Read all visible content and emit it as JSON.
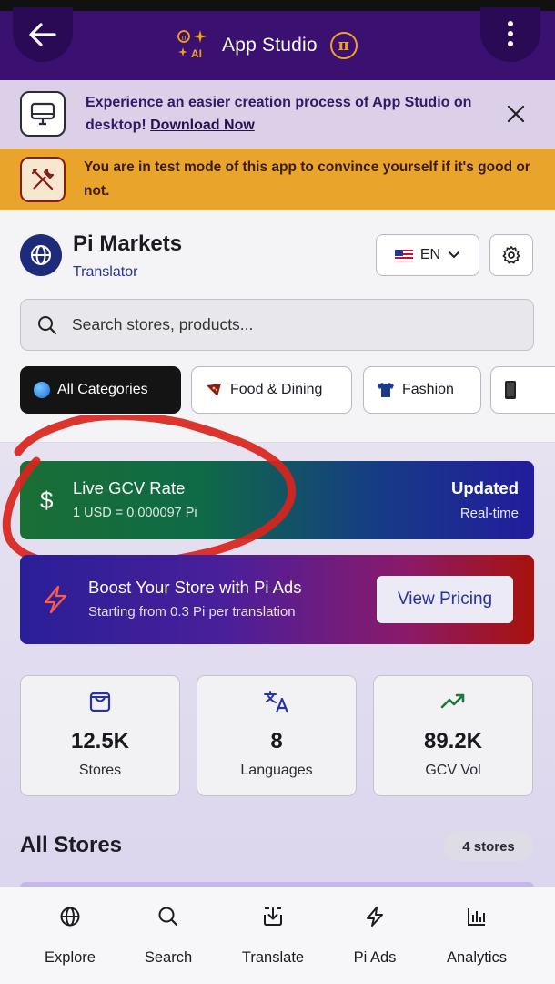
{
  "app_bar": {
    "title": "App Studio",
    "ai_badge": "AI",
    "pi_symbol": "π"
  },
  "desktop_banner": {
    "text": "Experience an easier creation process of App Studio on desktop!",
    "link": "Download Now",
    "icon": "monitor-icon"
  },
  "test_banner": {
    "text": "You are in test mode of this app to convince yourself if it's good or not.",
    "icon": "tools-icon"
  },
  "store": {
    "name": "Pi Markets",
    "subtitle": "Translator",
    "language": "EN",
    "icon": "globe-icon"
  },
  "search": {
    "placeholder": "Search stores, products..."
  },
  "categories": [
    {
      "label": "All Categories",
      "active": true
    },
    {
      "label": "Food & Dining",
      "active": false
    },
    {
      "label": "Fashion",
      "active": false
    }
  ],
  "gcv": {
    "currency_symbol": "$",
    "title": "Live GCV Rate",
    "rate": "1 USD = 0.000097 Pi",
    "status": "Updated",
    "status_sub": "Real-time"
  },
  "ads": {
    "title": "Boost Your Store with Pi Ads",
    "subtitle": "Starting from 0.3 Pi per translation",
    "button": "View Pricing"
  },
  "stats": [
    {
      "value": "12.5K",
      "label": "Stores",
      "icon": "shopping-bag-icon"
    },
    {
      "value": "8",
      "label": "Languages",
      "icon": "translate-icon"
    },
    {
      "value": "89.2K",
      "label": "GCV Vol",
      "icon": "trending-up-icon"
    }
  ],
  "stores_section": {
    "title": "All Stores",
    "count": "4 stores"
  },
  "nav": [
    {
      "label": "Explore",
      "icon": "globe-icon"
    },
    {
      "label": "Search",
      "icon": "search-icon"
    },
    {
      "label": "Translate",
      "icon": "download-box-icon"
    },
    {
      "label": "Pi Ads",
      "icon": "lightning-icon"
    },
    {
      "label": "Analytics",
      "icon": "bar-chart-icon"
    }
  ],
  "colors": {
    "app_bar": "#3a1070",
    "test_banner": "#e9a42b",
    "accent_blue": "#2632a6",
    "annotation_red": "#d9241c"
  }
}
